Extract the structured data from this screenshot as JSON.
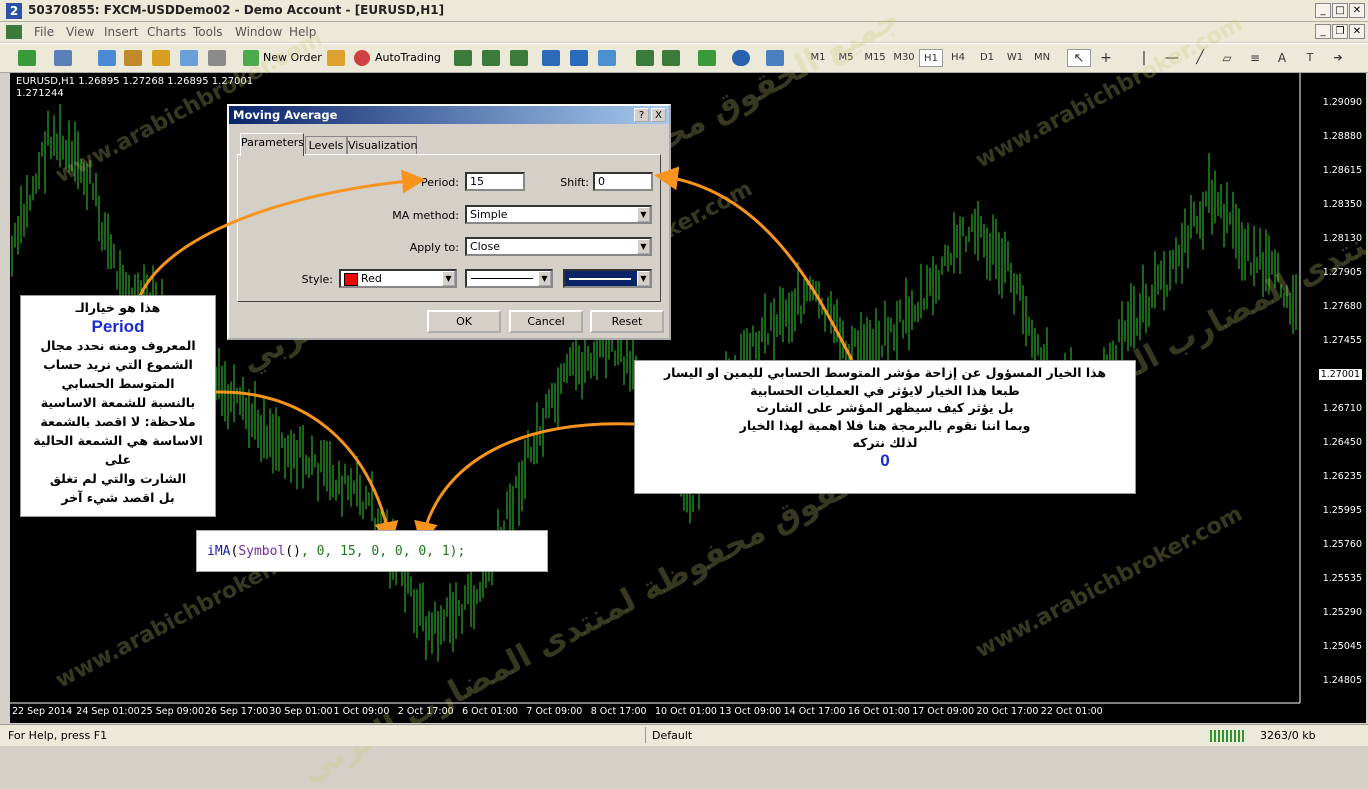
{
  "window": {
    "title": "50370855: FXCM-USDDemo02 - Demo Account - [EURUSD,H1]",
    "app_icon": "2"
  },
  "menu": [
    "File",
    "View",
    "Insert",
    "Charts",
    "Tools",
    "Window",
    "Help"
  ],
  "toolbar": {
    "new_order": "New Order",
    "autotrading": "AutoTrading",
    "timeframes": [
      "M1",
      "M5",
      "M15",
      "M30",
      "H1",
      "H4",
      "D1",
      "W1",
      "MN"
    ],
    "active_timeframe": "H1"
  },
  "chart": {
    "header": "EURUSD,H1  1.26895 1.27268 1.26895 1.27001",
    "sub_header": "1.271244",
    "price_labels": [
      "1.29090",
      "1.28880",
      "1.28615",
      "1.28350",
      "1.28130",
      "1.27905",
      "1.27680",
      "1.27455",
      "1.27001",
      "1.26710",
      "1.26450",
      "1.26235",
      "1.25995",
      "1.25760",
      "1.25535",
      "1.25290",
      "1.25045",
      "1.24805"
    ],
    "current_price": "1.27001",
    "time_labels": [
      "22 Sep 2014",
      "24 Sep 01:00",
      "25 Sep 09:00",
      "26 Sep 17:00",
      "30 Sep 01:00",
      "1 Oct 09:00",
      "2 Oct 17:00",
      "6 Oct 01:00",
      "7 Oct 09:00",
      "8 Oct 17:00",
      "10 Oct 01:00",
      "13 Oct 09:00",
      "14 Oct 17:00",
      "16 Oct 01:00",
      "17 Oct 09:00",
      "20 Oct 17:00",
      "22 Oct 01:00"
    ],
    "candle_color": "#2fcf2f"
  },
  "dialog": {
    "title": "Moving Average",
    "help_btn": "?",
    "close_btn": "X",
    "tabs": [
      "Parameters",
      "Levels",
      "Visualization"
    ],
    "period_label": "Period:",
    "period_value": "15",
    "shift_label": "Shift:",
    "shift_value": "0",
    "method_label": "MA method:",
    "method_value": "Simple",
    "apply_label": "Apply to:",
    "apply_value": "Close",
    "style_label": "Style:",
    "style_color_name": "Red",
    "style_color": "#ff0000",
    "ok": "OK",
    "cancel": "Cancel",
    "reset": "Reset"
  },
  "notes": {
    "left_lines": [
      "هذا هو خيارالـ",
      "Period",
      "المعروف ومنه نحدد مجال",
      "الشموع التي نريد حساب",
      "المتوسط الحسابي",
      "بالنسبة للشمعة الاساسية",
      "ملاحظة: لا اقصد بالشمعة",
      "الاساسة هي الشمعة الحالية على",
      "الشارت والتي لم تغلق",
      "بل اقصد شيء آخر"
    ],
    "right_lines": [
      "هذا الخيار المسؤول عن إزاحة مؤشر المتوسط الحسابي لليمين او اليسار",
      "طبعا هذا الخيار لايؤثر في العمليات الحسابية",
      "بل يؤثر كيف سيظهر المؤشر على الشارت",
      "وبما اننا نقوم بالبرمجة هنا فلا اهمية لهذا الخيار",
      "لذلك نتركه",
      "0"
    ],
    "code": {
      "fn": "iMA",
      "open": "(",
      "sym": "Symbol",
      "symparen": "()",
      "a1": ", 0, ",
      "period": "15",
      "c1": ", ",
      "shift": "0",
      "rest": ", 0, 0, 1);"
    }
  },
  "watermark": {
    "site": "www.arabichbroker.com",
    "rights": "جميع الحقوق محفوظة لمنتدى المضارب العربي"
  },
  "status": {
    "help": "For Help, press F1",
    "profile": "Default",
    "traffic": "3263/0 kb"
  }
}
